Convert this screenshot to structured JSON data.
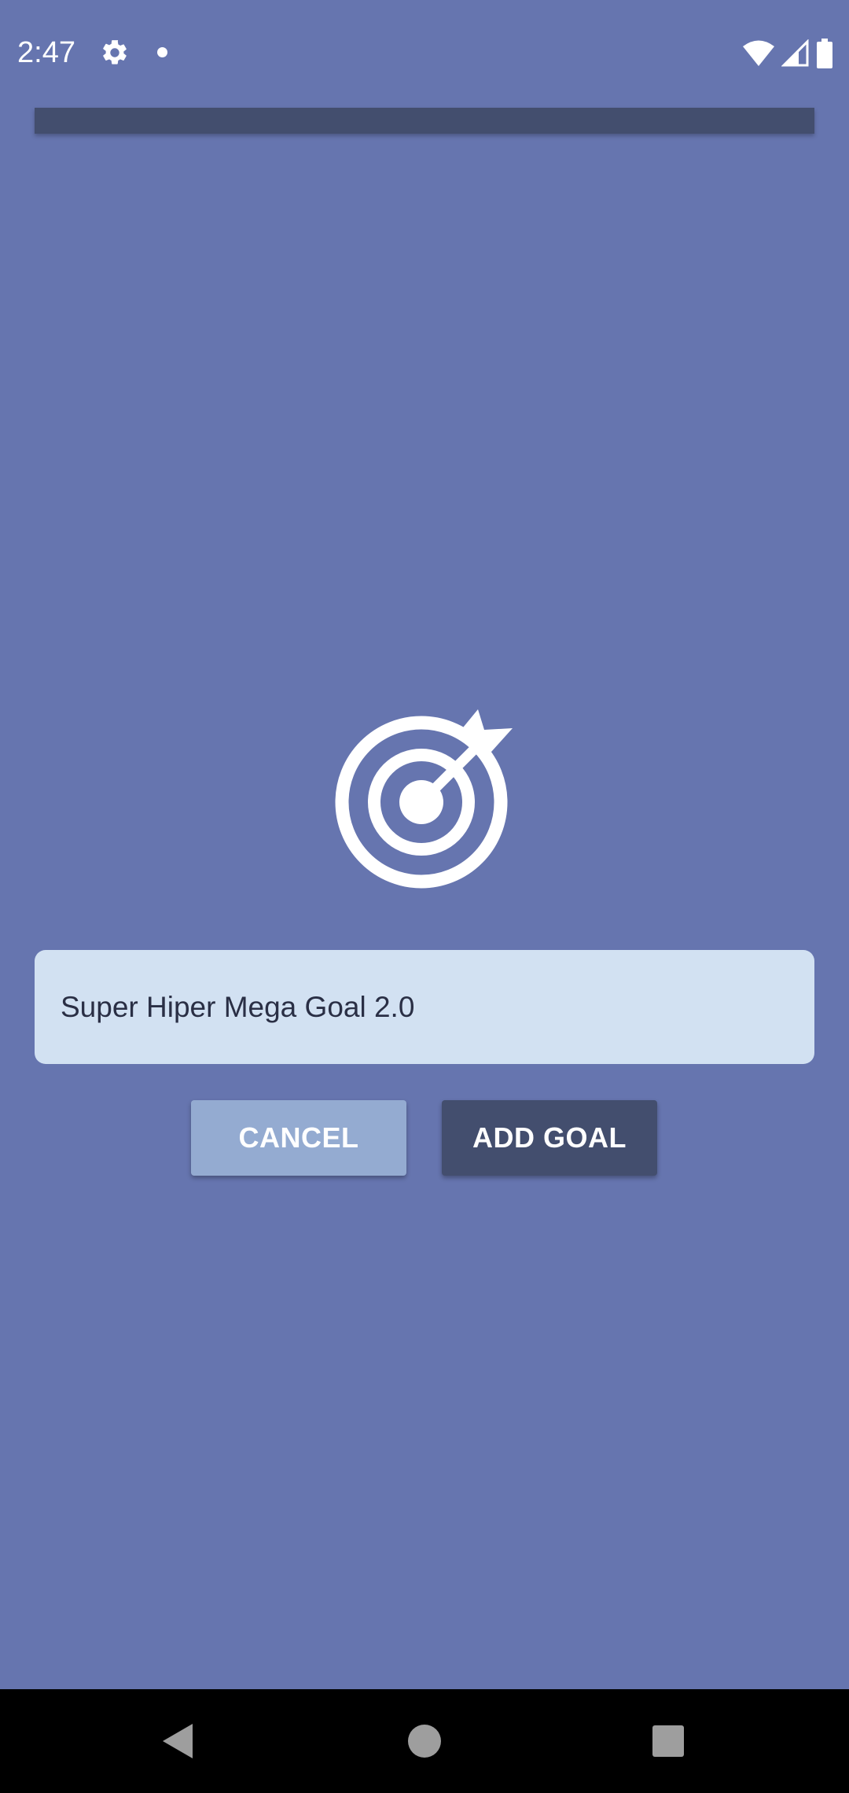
{
  "colors": {
    "background": "#6675AF",
    "top_strip": "#434E6E",
    "input_background": "#D2E1F2",
    "input_text": "#2A2F45",
    "cancel_button": "#94ABD1",
    "add_button": "#434E6E",
    "nav_bar": "#000000",
    "nav_icons": "#9E9E9E",
    "white": "#FFFFFF"
  },
  "status_bar": {
    "time": "2:47",
    "icons": [
      "gear-icon",
      "notification-dot-icon",
      "wifi-icon",
      "cell-signal-icon",
      "battery-icon"
    ]
  },
  "goal_form": {
    "icon": "target-icon",
    "input_value": "Super Hiper Mega Goal 2.0",
    "cancel_label": "CANCEL",
    "add_label": "ADD GOAL"
  },
  "nav_bar": {
    "icons": [
      "back-icon",
      "home-icon",
      "recents-icon"
    ]
  }
}
